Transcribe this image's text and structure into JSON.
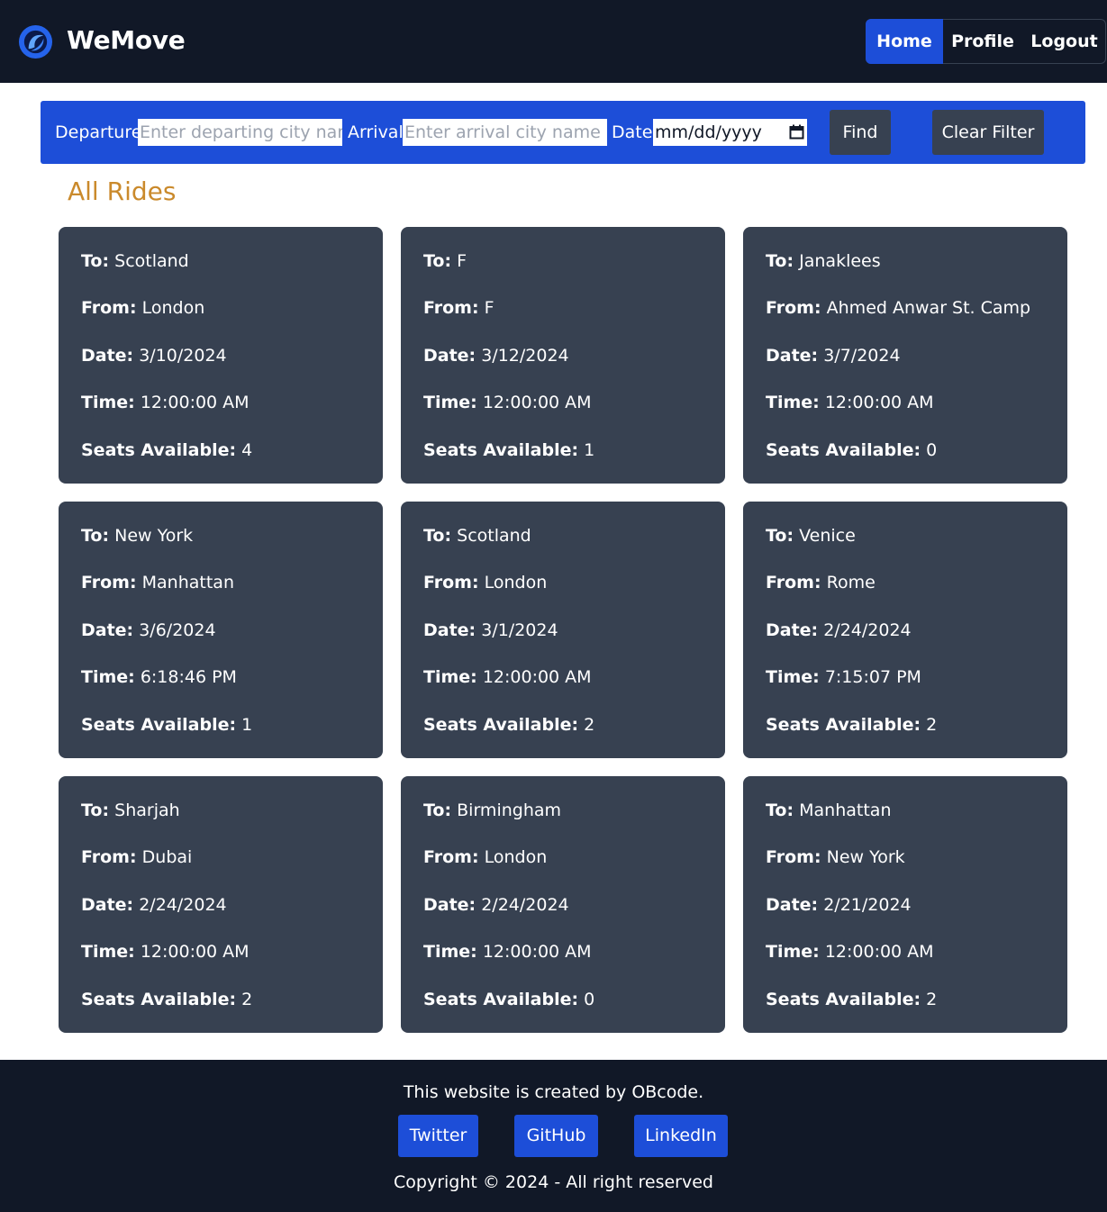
{
  "header": {
    "brand": "WeMove",
    "nav": {
      "home": "Home",
      "profile": "Profile",
      "logout": "Logout"
    }
  },
  "filter": {
    "departure_label": "Departure",
    "departure_placeholder": "Enter departing city name",
    "arrival_label": "Arrival",
    "arrival_placeholder": "Enter arrival city name",
    "date_label": "Date",
    "date_value": "mm/dd/yyyy",
    "find_label": "Find",
    "clear_label": "Clear Filter"
  },
  "section_title": "All Rides",
  "field_labels": {
    "to": "To:",
    "from": "From:",
    "date": "Date:",
    "time": "Time:",
    "seats": "Seats Available:"
  },
  "rides": [
    {
      "to": "Scotland",
      "from": "London",
      "date": "3/10/2024",
      "time": "12:00:00 AM",
      "seats": "4"
    },
    {
      "to": "F",
      "from": "F",
      "date": "3/12/2024",
      "time": "12:00:00 AM",
      "seats": "1"
    },
    {
      "to": "Janaklees",
      "from": "Ahmed Anwar St. Camp",
      "date": "3/7/2024",
      "time": "12:00:00 AM",
      "seats": "0"
    },
    {
      "to": "New York",
      "from": "Manhattan",
      "date": "3/6/2024",
      "time": "6:18:46 PM",
      "seats": "1"
    },
    {
      "to": "Scotland",
      "from": "London",
      "date": "3/1/2024",
      "time": "12:00:00 AM",
      "seats": "2"
    },
    {
      "to": "Venice",
      "from": "Rome",
      "date": "2/24/2024",
      "time": "7:15:07 PM",
      "seats": "2"
    },
    {
      "to": "Sharjah",
      "from": "Dubai",
      "date": "2/24/2024",
      "time": "12:00:00 AM",
      "seats": "2"
    },
    {
      "to": "Birmingham",
      "from": "London",
      "date": "2/24/2024",
      "time": "12:00:00 AM",
      "seats": "0"
    },
    {
      "to": "Manhattan",
      "from": "New York",
      "date": "2/21/2024",
      "time": "12:00:00 AM",
      "seats": "2"
    }
  ],
  "footer": {
    "created_by": "This website is created by OBcode.",
    "links": {
      "twitter": "Twitter",
      "github": "GitHub",
      "linkedin": "LinkedIn"
    },
    "copyright": "Copyright © 2024 - All right reserved"
  },
  "colors": {
    "nav_bg": "#111827",
    "accent": "#1d4ed8",
    "card_bg": "#374151",
    "title": "#ca8a2c"
  }
}
